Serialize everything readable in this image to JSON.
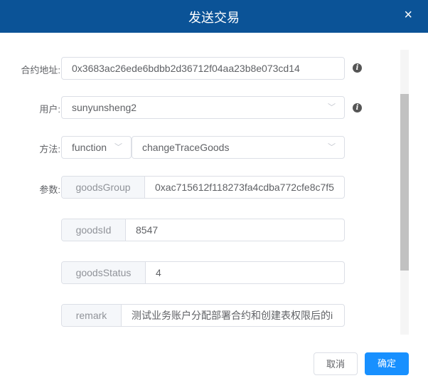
{
  "dialog": {
    "title": "发送交易",
    "close_icon": "×"
  },
  "form": {
    "contract_label": "合约地址:",
    "contract_address": "0x3683ac26ede6bdbb2d36712f04aa23b8e073cd14",
    "user_label": "用户:",
    "user": "sunyunsheng2",
    "method_label": "方法:",
    "method_type": "function",
    "method_name": "changeTraceGoods",
    "params_label": "参数:",
    "params": [
      {
        "name": "goodsGroup",
        "value": "0xac715612f118273fa4cdba772cfe8c7f5"
      },
      {
        "name": "goodsId",
        "value": "8547"
      },
      {
        "name": "goodsStatus",
        "value": "4"
      },
      {
        "name": "remark",
        "value": "测试业务账户分配部署合约和创建表权限后的i"
      }
    ]
  },
  "footer": {
    "cancel": "取消",
    "confirm": "确定"
  },
  "colors": {
    "header": "#0b5397",
    "primary": "#1890ff"
  }
}
